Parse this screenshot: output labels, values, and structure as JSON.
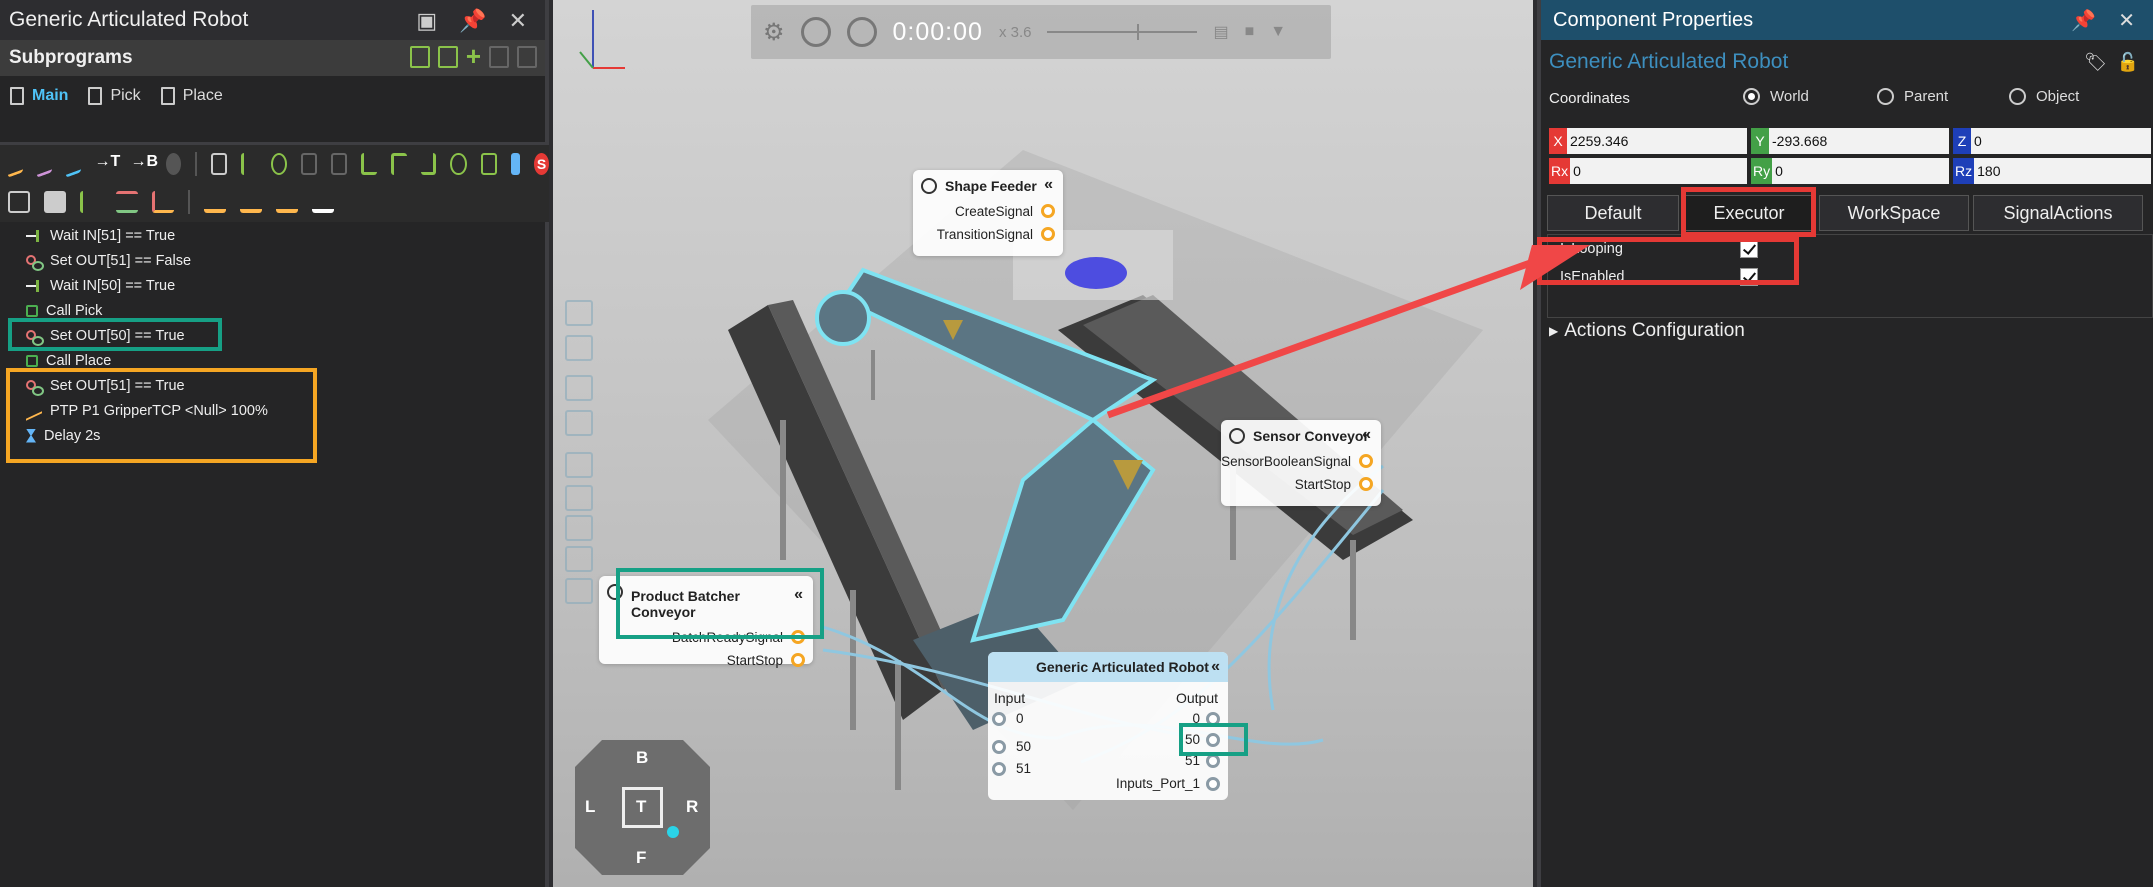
{
  "left_panel": {
    "title": "Generic Articulated Robot",
    "subprograms_label": "Subprograms",
    "tabs": [
      {
        "label": "Main",
        "active": true
      },
      {
        "label": "Pick",
        "active": false
      },
      {
        "label": "Place",
        "active": false
      }
    ],
    "statements": [
      {
        "icon": "wait",
        "text": "Wait IN[51] == True"
      },
      {
        "icon": "set",
        "text": "Set OUT[51] == False"
      },
      {
        "icon": "wait",
        "text": "Wait IN[50] == True"
      },
      {
        "icon": "call",
        "text": "Call Pick"
      },
      {
        "icon": "set",
        "text": "Set OUT[50] == True"
      },
      {
        "icon": "call",
        "text": "Call Place"
      },
      {
        "icon": "set",
        "text": "Set OUT[51] == True"
      },
      {
        "icon": "ptp",
        "text": "PTP P1 GripperTCP <Null> 100%"
      },
      {
        "icon": "delay",
        "text": "Delay 2s"
      }
    ]
  },
  "viewport": {
    "playback": {
      "time": "0:00:00",
      "speed": "x 3.6"
    },
    "shape_feeder": {
      "title": "Shape Feeder",
      "collapse": "«",
      "ports": [
        "CreateSignal",
        "TransitionSignal"
      ]
    },
    "sensor_conveyor": {
      "title": "Sensor Conveyor",
      "collapse": "«",
      "ports": [
        "SensorBooleanSignal",
        "StartStop"
      ]
    },
    "batcher_conveyor": {
      "title": "Product Batcher Conveyor",
      "collapse": "«",
      "ports": [
        "BatchReadySignal",
        "StartStop"
      ]
    },
    "robot_node": {
      "title": "Generic Articulated Robot",
      "collapse": "«",
      "input_label": "Input",
      "output_label": "Output",
      "inputs": [
        "0",
        "50",
        "51"
      ],
      "outputs": [
        "0",
        "50",
        "51",
        "Inputs_Port_1"
      ]
    },
    "navcube": {
      "top": "B",
      "left": "L",
      "center": "T",
      "right": "R",
      "bottom": "F"
    }
  },
  "right_panel": {
    "title": "Component Properties",
    "component_name": "Generic Articulated Robot",
    "coordinates_label": "Coordinates",
    "frames": [
      {
        "label": "World",
        "selected": true
      },
      {
        "label": "Parent",
        "selected": false
      },
      {
        "label": "Object",
        "selected": false
      }
    ],
    "fields_row1": [
      {
        "label": "X",
        "value": "2259.346",
        "color": "#e53935"
      },
      {
        "label": "Y",
        "value": "-293.668",
        "color": "#43a047"
      },
      {
        "label": "Z",
        "value": "0",
        "color": "#1e3fb8"
      }
    ],
    "fields_row2": [
      {
        "label": "Rx",
        "value": "0",
        "color": "#e53935"
      },
      {
        "label": "Ry",
        "value": "0",
        "color": "#43a047"
      },
      {
        "label": "Rz",
        "value": "180",
        "color": "#1e3fb8"
      }
    ],
    "tabs": [
      {
        "label": "Default",
        "active": false
      },
      {
        "label": "Executor",
        "active": true
      },
      {
        "label": "WorkSpace",
        "active": false
      },
      {
        "label": "SignalActions",
        "active": false
      }
    ],
    "properties": [
      {
        "label": "IsLooping",
        "checked": true
      },
      {
        "label": "IsEnabled",
        "checked": true
      }
    ],
    "actions_label": "Actions Configuration"
  }
}
